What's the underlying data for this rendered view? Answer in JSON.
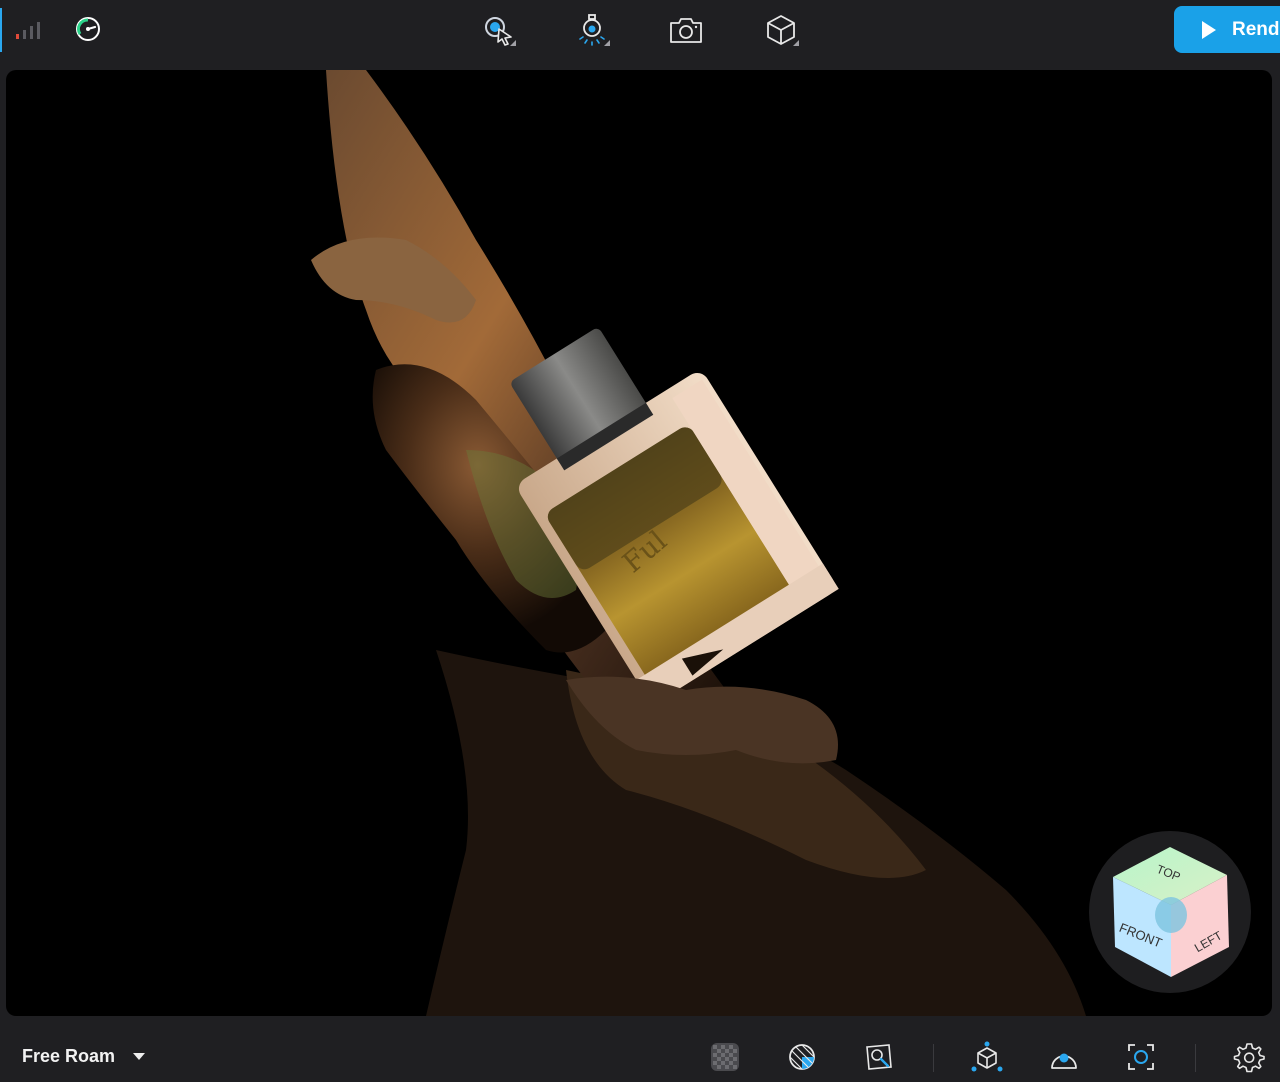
{
  "toolbar": {
    "tools": [
      {
        "name": "select-tool",
        "icon": "cursor-select-icon"
      },
      {
        "name": "light-tool",
        "icon": "lightbulb-icon"
      },
      {
        "name": "camera-tool",
        "icon": "camera-icon"
      },
      {
        "name": "object-tool",
        "icon": "cube-icon"
      }
    ],
    "render_label": "Rend",
    "render_color": "#1aa1e8"
  },
  "viewport": {
    "nav_cube": {
      "top_label": "TOP",
      "front_label": "FRONT",
      "left_label": "LEFT"
    }
  },
  "bottombar": {
    "mode_label": "Free Roam",
    "tools": [
      {
        "name": "transparency-toggle",
        "icon": "checkerboard-icon"
      },
      {
        "name": "material-toggle",
        "icon": "material-sphere-icon"
      },
      {
        "name": "pick-focus",
        "icon": "focus-pick-icon"
      },
      {
        "name": "pivot-tool",
        "icon": "pivot-axis-icon"
      },
      {
        "name": "orbit-target",
        "icon": "target-dome-icon"
      },
      {
        "name": "frame-view",
        "icon": "frame-focus-icon"
      },
      {
        "name": "settings",
        "icon": "gear-icon"
      }
    ]
  }
}
